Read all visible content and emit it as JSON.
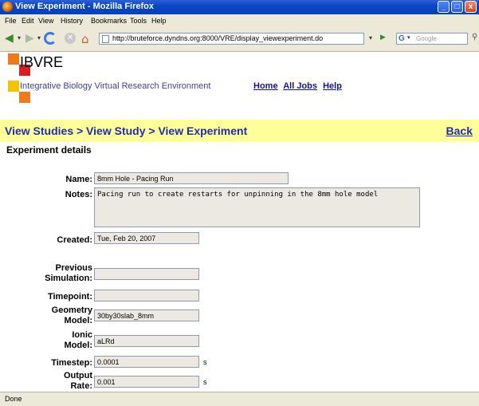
{
  "window": {
    "title": "View Experiment - Mozilla Firefox",
    "minimize": "_",
    "maximize": "□",
    "close": "x"
  },
  "menu": {
    "file": "File",
    "edit": "Edit",
    "view": "View",
    "history": "History",
    "bookmarks": "Bookmarks",
    "tools": "Tools",
    "help": "Help"
  },
  "nav": {
    "url": "http://bruteforce.dyndns.org:8000/VRE/display_viewexperiment.do",
    "search_placeholder": "Google",
    "search_engine": "G"
  },
  "header": {
    "brand": "IBVRE",
    "tagline": "Integrative Biology Virtual Research Environment",
    "links": {
      "home": "Home",
      "all_jobs": "All Jobs",
      "help": "Help"
    },
    "logo_colors": [
      "#f07a1a",
      "#d81e1e",
      "#f5c400",
      "#f07a1a"
    ]
  },
  "breadcrumb": {
    "text": "View Studies > View Study > View Experiment",
    "back": "Back"
  },
  "section_title": "Experiment details",
  "form": {
    "name_label": "Name:",
    "name_value": "8mm Hole - Pacing Run",
    "notes_label": "Notes:",
    "notes_value": "Pacing run to create restarts for unpinning in the 8mm hole model",
    "created_label": "Created:",
    "created_value": "Tue, Feb 20, 2007",
    "previous_simulation_label_1": "Previous",
    "previous_simulation_label_2": "Simulation:",
    "previous_simulation_value": "",
    "timepoint_label": "Timepoint:",
    "timepoint_value": "",
    "geometry_label_1": "Geometry",
    "geometry_label_2": "Model:",
    "geometry_value": "30by30slab_8mm",
    "ionic_label_1": "Ionic",
    "ionic_label_2": "Model:",
    "ionic_value": "aLRd",
    "timestep_label": "Timestep:",
    "timestep_value": "0.0001",
    "timestep_unit": "s",
    "output_rate_label_1": "Output",
    "output_rate_label_2": "Rate:",
    "output_rate_value": "0.001",
    "output_rate_unit": "s"
  },
  "status": {
    "text": "Done"
  }
}
